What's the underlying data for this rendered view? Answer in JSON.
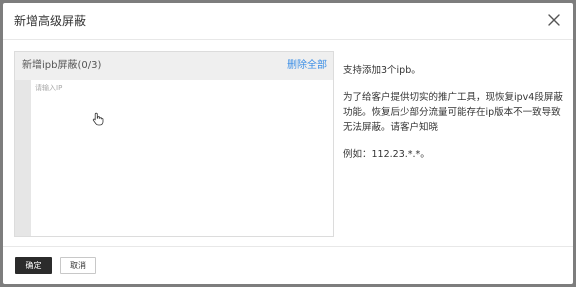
{
  "dialog": {
    "title": "新增高级屏蔽",
    "close_icon": "close-icon"
  },
  "panel": {
    "title": "新增ipb屏蔽(0/3)",
    "delete_all_label": "删除全部",
    "input_placeholder": "请输入IP",
    "input_value": ""
  },
  "info": {
    "line1": "支持添加3个ipb。",
    "line2": "为了给客户提供切实的推广工具，现恢复ipv4段屏蔽功能。恢复后少部分流量可能存在ip版本不一致导致无法屏蔽。请客户知晓",
    "line3": "例如：112.23.*.*。"
  },
  "footer": {
    "confirm_label": "确定",
    "cancel_label": "取消"
  },
  "colors": {
    "link": "#3a8ee6",
    "primary_button": "#2b2b2b",
    "overlay": "#7d7d7d"
  }
}
